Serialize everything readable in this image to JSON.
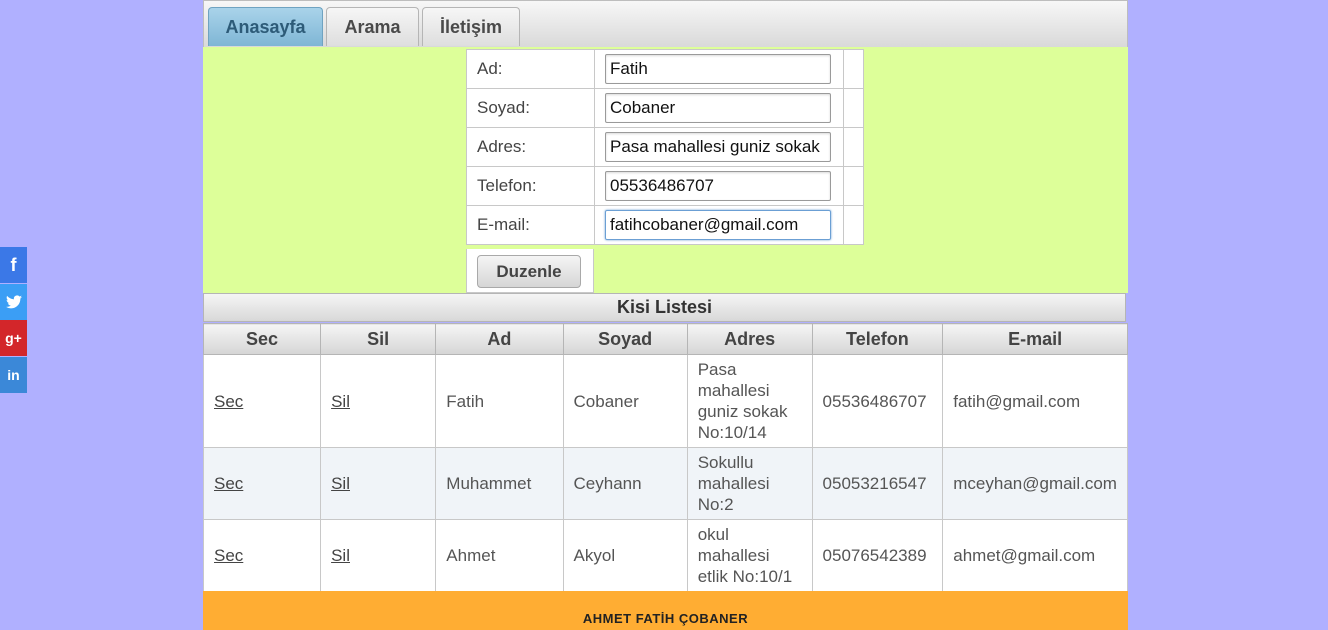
{
  "social": {
    "facebook": "f",
    "twitter": "🐦",
    "googleplus": "g+",
    "linkedin": "in"
  },
  "tabs": [
    {
      "label": "Anasayfa",
      "active": true
    },
    {
      "label": "Arama",
      "active": false
    },
    {
      "label": "İletişim",
      "active": false
    }
  ],
  "form": {
    "fields": [
      {
        "label": "Ad:",
        "value": "Fatih"
      },
      {
        "label": "Soyad:",
        "value": "Cobaner"
      },
      {
        "label": "Adres:",
        "value": "Pasa mahallesi guniz sokak"
      },
      {
        "label": "Telefon:",
        "value": "05536486707"
      },
      {
        "label": "E-mail:",
        "value": "fatihcobaner@gmail.com"
      }
    ],
    "submit_label": "Duzenle"
  },
  "list": {
    "title": "Kisi Listesi",
    "columns": [
      "Sec",
      "Sil",
      "Ad",
      "Soyad",
      "Adres",
      "Telefon",
      "E-mail"
    ],
    "rows": [
      {
        "sec": "Sec",
        "sil": "Sil",
        "ad": "Fatih",
        "soyad": "Cobaner",
        "adres": "Pasa mahallesi guniz sokak No:10/14",
        "telefon": "05536486707",
        "email": "fatih@gmail.com"
      },
      {
        "sec": "Sec",
        "sil": "Sil",
        "ad": "Muhammet",
        "soyad": "Ceyhann",
        "adres": "Sokullu mahallesi No:2",
        "telefon": "05053216547",
        "email": "mceyhan@gmail.com"
      },
      {
        "sec": "Sec",
        "sil": "Sil",
        "ad": "Ahmet",
        "soyad": "Akyol",
        "adres": "okul mahallesi etlik No:10/1",
        "telefon": "05076542389",
        "email": "ahmet@gmail.com"
      }
    ]
  },
  "footer": {
    "text": "AHMET FATİH ÇOBANER"
  },
  "colors": {
    "background": "#b0b0ff",
    "form_bg": "#ddff99",
    "footer_bg": "#ffad33",
    "active_tab": "#7fb6d5"
  }
}
